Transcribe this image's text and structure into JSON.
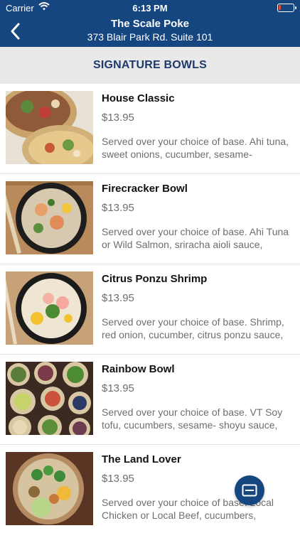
{
  "status": {
    "carrier": "Carrier",
    "time": "6:13 PM",
    "battery_level": 0.15
  },
  "nav": {
    "title": "The Scale Poke",
    "subtitle": "373 Blair Park Rd. Suite 101"
  },
  "section": {
    "title": "SIGNATURE BOWLS"
  },
  "items": [
    {
      "name": "House Classic",
      "price": "$13.95",
      "description": "Served over your choice of base. Ahi tuna, sweet onions, cucumber, sesame-"
    },
    {
      "name": "Firecracker Bowl",
      "price": "$13.95",
      "description": "Served over your choice of base. Ahi Tuna or Wild Salmon, sriracha aioli sauce,"
    },
    {
      "name": "Citrus Ponzu Shrimp",
      "price": "$13.95",
      "description": "Served over your choice of base. Shrimp, red onion, cucumber, citrus ponzu sauce,"
    },
    {
      "name": "Rainbow Bowl",
      "price": "$13.95",
      "description": "Served over your choice of base. VT Soy tofu, cucumbers, sesame- shoyu sauce,"
    },
    {
      "name": "The Land Lover",
      "price": "$13.95",
      "description": "Served over your choice of base. Local Chicken or Local Beef, cucumbers,"
    }
  ],
  "colors": {
    "nav": "#16467f",
    "section_bg": "#e9e9ea",
    "section_text": "#1e3a6b",
    "battery": "#e0463a"
  },
  "icons": {
    "back": "chevron-left-icon",
    "wifi": "wifi-icon",
    "fab": "cart-icon"
  }
}
